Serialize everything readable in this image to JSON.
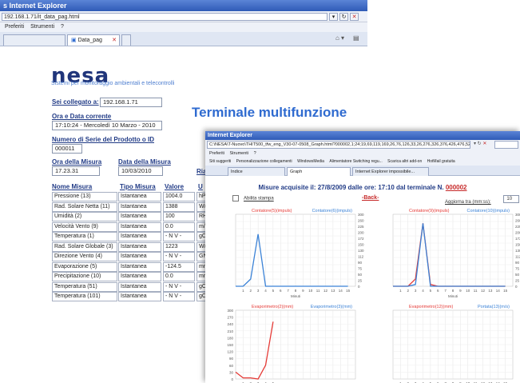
{
  "window1": {
    "title": "s Internet Explorer",
    "address": "192.168.1.71/it_data_pag.html",
    "menu": [
      "Preferiti",
      "Strumenti",
      "?"
    ],
    "tabs": [
      {
        "label": "Data_pag"
      }
    ]
  },
  "page": {
    "logo": "nesa",
    "subtitle": "Sistemi per monitoraggio ambientali e telecontrolli",
    "connected_label": "Sei collegato a:",
    "connected_value": "192.168.1.71",
    "datetime_label": "Ora e Data corrente",
    "datetime_value": "17:10:24 - Mercoledì 10 Marzo - 2010",
    "serial_label": "Numero di Serie del Prodotto o ID",
    "serial_value": "000011",
    "measure_time_label": "Ora della Misura",
    "measure_time_value": "17.23.31",
    "measure_date_label": "Data della Misura",
    "measure_date_value": "10/03/2010",
    "extra_label": "Ria",
    "terminal_title": "Terminale multifunzione",
    "table": {
      "headers": [
        "Nome Misura",
        "Tipo Misura",
        "Valore",
        "U"
      ],
      "rows": [
        [
          "Pressione (13)",
          "Istantanea",
          "1004.0",
          "hPa"
        ],
        [
          "Rad. Solare Netta (11)",
          "Istantanea",
          "1388",
          "W/n"
        ],
        [
          "Umidità (2)",
          "Istantanea",
          "100",
          "RH%"
        ],
        [
          "Velocità Vento (9)",
          "Istantanea",
          "0.0",
          "m/s"
        ],
        [
          "Temperatura (1)",
          "Istantanea",
          "- N V -",
          "gC"
        ],
        [
          "Rad. Solare Globale (3)",
          "Istantanea",
          "1223",
          "W/n"
        ],
        [
          "Direzione Vento (4)",
          "Istantanea",
          "- N V -",
          "GN"
        ],
        [
          "Evaporazione (5)",
          "Istantanea",
          "-124.5",
          "mm"
        ],
        [
          "Precipitazione (10)",
          "Istantanea",
          "0.0",
          "mm"
        ],
        [
          "Temperatura (51)",
          "Istantanea",
          "- N V -",
          "gC"
        ],
        [
          "Temperatura (101)",
          "Istantanea",
          "- N V -",
          "gC"
        ]
      ]
    }
  },
  "window2": {
    "title": "Internet Explorer",
    "address": "C:\\NESA\\T-Nuovo\\THIT500_tfw_eng_V30-07-0508_Graph.html?000002,1;24;19,69,119,169,26,76,126,33,26,276,326,376,426,476,526,576,626,676,726,??",
    "menu": [
      "Preferiti",
      "Strumenti",
      "?"
    ],
    "links": [
      "Siti suggeriti",
      "Personalizzazione collegamenti",
      "WindowsMedia",
      "Alimentatore Switching regu...",
      "Scarica altri add-on",
      "HotMail gratuita"
    ],
    "tabs": [
      {
        "label": "Indice"
      },
      {
        "label": "Graph"
      },
      {
        "label": "Internet Explorer impossibile..."
      }
    ],
    "header_prefix": "Misure acquisite il: 27/8/2009 dalle ore: 17:10 dal terminale N.",
    "header_number": "000002",
    "print_label": "Abilita stampa",
    "back_label": "-Back-",
    "refresh_label": "Aggiorna tra (mm:ss):",
    "refresh_value": "10"
  },
  "chart_data": [
    {
      "type": "line",
      "title": "Contatore(5)(impuls)",
      "secondary_title": "Contatore(6)(impuls)",
      "x": [
        0,
        1,
        2,
        3,
        4,
        5,
        6,
        7,
        8,
        9,
        10,
        11,
        12,
        13,
        14,
        15
      ],
      "series": [
        {
          "name": "Contatore(5)(impuls)",
          "color": "#3b82d6",
          "values": [
            0,
            0,
            8,
            58,
            0,
            0,
            0,
            0,
            0,
            0,
            0,
            0,
            0,
            0,
            0,
            0
          ]
        }
      ],
      "ylim": [
        0,
        80
      ],
      "right_ticks": [
        "300",
        "260",
        "225",
        "200",
        "172",
        "150",
        "130",
        "112",
        "90",
        "75",
        "50",
        "25",
        "0"
      ],
      "xlabel": "Minuti",
      "grid": true
    },
    {
      "type": "line",
      "title": "Contatore(9)(impuls)",
      "secondary_title": "Contatore(10)(impuls)",
      "x": [
        0,
        1,
        2,
        3,
        4,
        5,
        6,
        7,
        8,
        9,
        10,
        11,
        12,
        13,
        14,
        15
      ],
      "series": [
        {
          "name": "Contatore(9)(impuls)",
          "color": "#e53935",
          "values": [
            0,
            0,
            0,
            8,
            70,
            2,
            0,
            0,
            0,
            0,
            0,
            0,
            0,
            0,
            0,
            0
          ]
        },
        {
          "name": "Contatore(10)(impuls)",
          "color": "#3b82d6",
          "values": [
            0,
            0,
            0,
            2,
            70,
            0,
            0,
            0,
            0,
            0,
            0,
            0,
            0,
            0,
            0,
            0
          ]
        }
      ],
      "ylim": [
        0,
        80
      ],
      "right_ticks": [
        "300",
        "260",
        "225",
        "200",
        "172",
        "150",
        "130",
        "112",
        "90",
        "75",
        "50",
        "25",
        "0"
      ],
      "xlabel": "Minuti",
      "grid": true
    },
    {
      "type": "line",
      "title": "Evaporimetro(2)(mm)",
      "secondary_title": "Evaporimetro(3)(mm)",
      "x": [
        0,
        1,
        2,
        3,
        4,
        5
      ],
      "series": [
        {
          "name": "Evaporimetro(2)(mm)",
          "color": "#e53935",
          "values": [
            30,
            5,
            5,
            0,
            60,
            250
          ]
        }
      ],
      "ylim": [
        0,
        300
      ],
      "left_ticks": [
        "300",
        "270",
        "240",
        "210",
        "180",
        "150",
        "120",
        "90",
        "60",
        "30",
        "0"
      ],
      "grid": true
    },
    {
      "type": "line",
      "title": "Evaporimetro(12)(mm)",
      "secondary_title": "Portata(13)(m/s)",
      "x": [
        0,
        1,
        2,
        3,
        4,
        5,
        6,
        7,
        8,
        9,
        10,
        11,
        12,
        13,
        14,
        15
      ],
      "series": [],
      "ylim": [
        0,
        100
      ],
      "grid": true
    }
  ]
}
